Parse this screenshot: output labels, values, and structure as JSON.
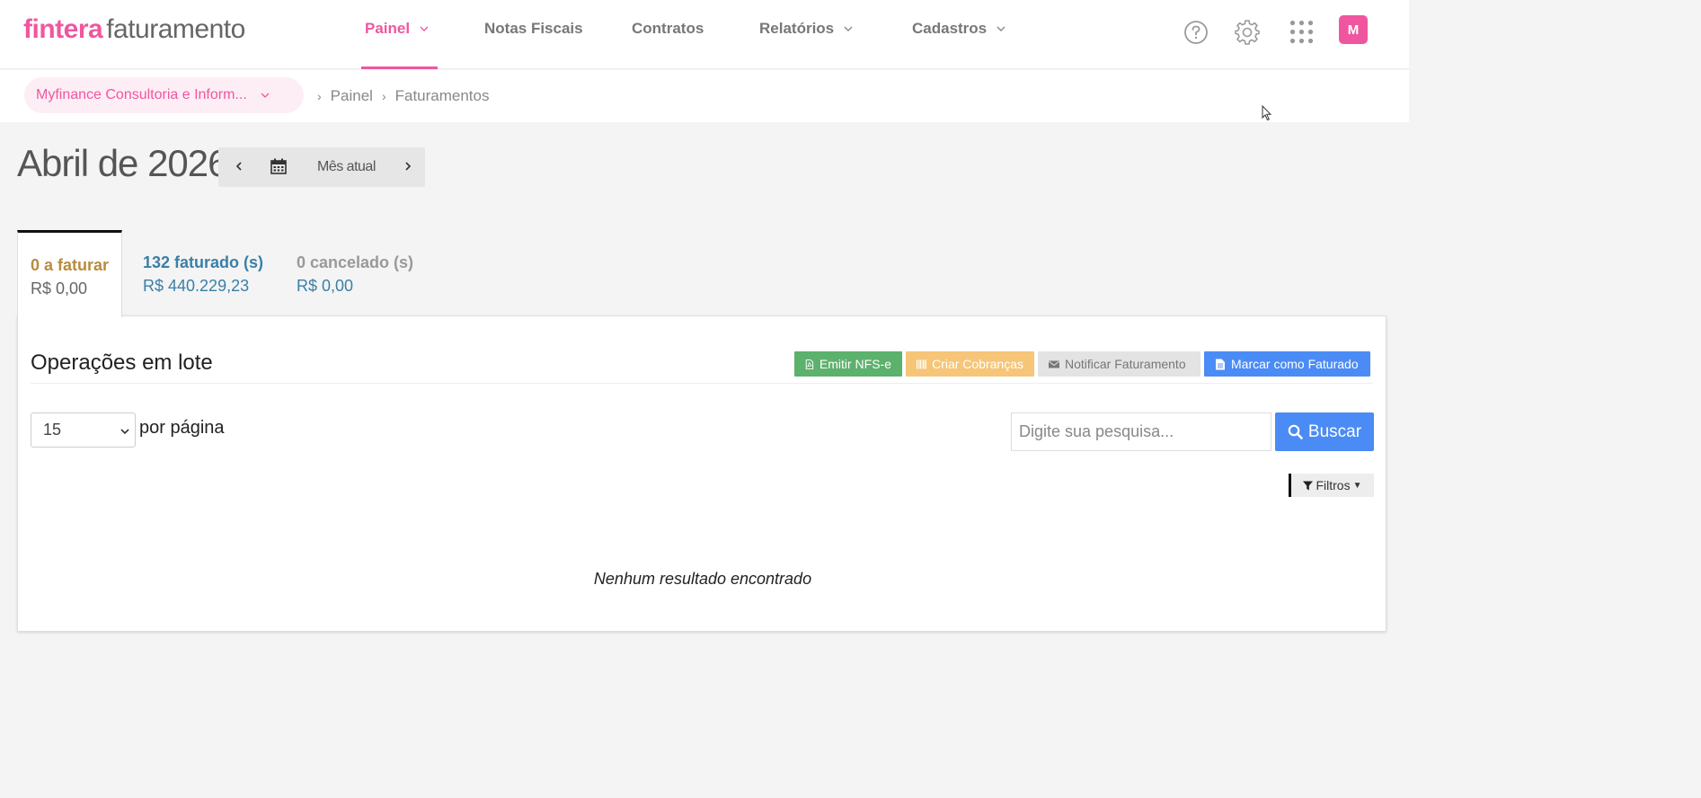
{
  "header": {
    "logo_brand": "fintera",
    "logo_product": "faturamento",
    "nav": [
      {
        "label": "Painel",
        "active": true,
        "has_dropdown": true
      },
      {
        "label": "Notas Fiscais",
        "active": false,
        "has_dropdown": false
      },
      {
        "label": "Contratos",
        "active": false,
        "has_dropdown": false
      },
      {
        "label": "Relatórios",
        "active": false,
        "has_dropdown": true
      },
      {
        "label": "Cadastros",
        "active": false,
        "has_dropdown": true
      }
    ],
    "icons": [
      "help-circle-icon",
      "gear-icon",
      "apps-grid-icon"
    ],
    "avatar_initial": "M"
  },
  "breadcrumb": {
    "company": "Myfinance Consultoria e Inform...",
    "items": [
      "Painel",
      "Faturamentos"
    ]
  },
  "period": {
    "title": "Abril de 2026",
    "current_label": "Mês atual"
  },
  "tabs": [
    {
      "label": "0 a faturar",
      "value": "R$ 0,00",
      "color": "#b98b3e",
      "value_color": "#666666",
      "active": true
    },
    {
      "label": "132 faturado (s)",
      "value": "R$ 440.229,23",
      "color": "#3a7fa8",
      "value_color": "#3a7fa8",
      "active": false
    },
    {
      "label": "0 cancelado (s)",
      "value": "R$ 0,00",
      "color": "#999999",
      "value_color": "#3a7fa8",
      "active": false
    }
  ],
  "panel": {
    "title": "Operações em lote",
    "actions": {
      "emitir": "Emitir NFS-e",
      "criar": "Criar Cobranças",
      "notificar": "Notificar Faturamento",
      "marcar": "Marcar como Faturado"
    },
    "per_page_value": "15",
    "per_page_label": "por página",
    "search_placeholder": "Digite sua pesquisa...",
    "search_button": "Buscar",
    "filter_button": "Filtros",
    "empty_message": "Nenhum resultado encontrado"
  },
  "colors": {
    "brand": "#f0569f",
    "success": "#5cb16d",
    "warning": "#f6c577",
    "primary": "#4b8bf5"
  }
}
